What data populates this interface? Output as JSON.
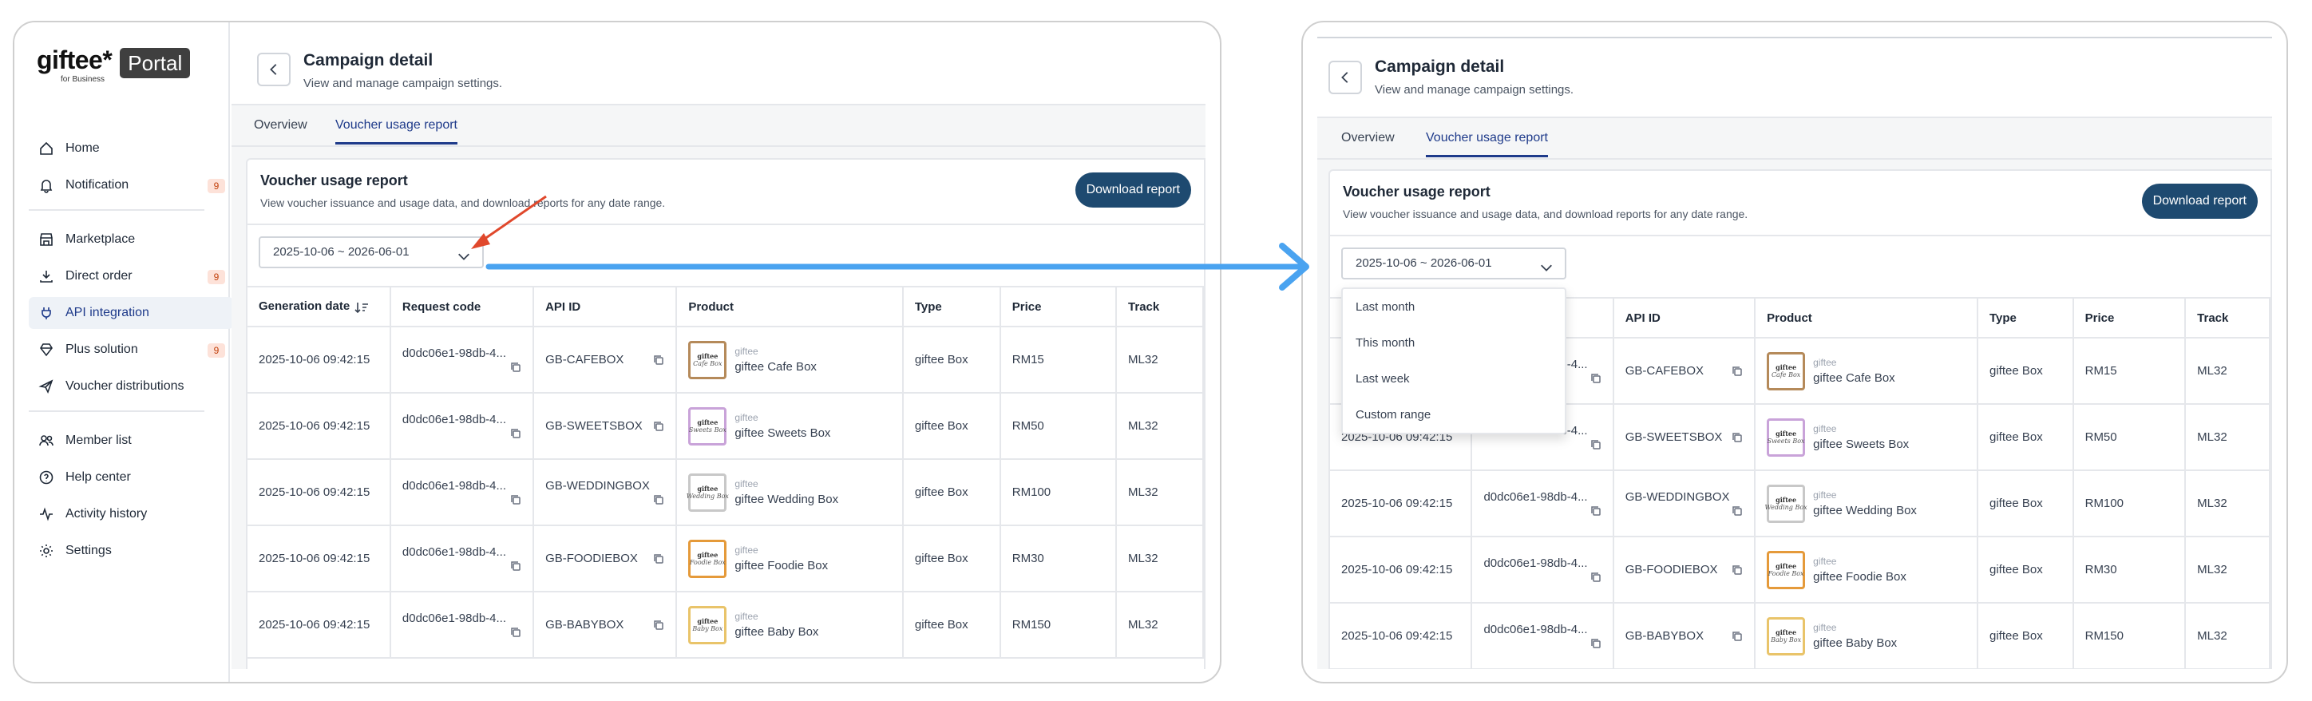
{
  "brand": {
    "logo_text": "giftee*",
    "logo_sub": "for Business",
    "portal_badge": "Portal"
  },
  "sidebar": {
    "groups": [
      [
        {
          "label": "Home",
          "icon": "home-icon",
          "badge": "",
          "active": false
        },
        {
          "label": "Notification",
          "icon": "bell-icon",
          "badge": "9",
          "active": false
        }
      ],
      [
        {
          "label": "Marketplace",
          "icon": "store-icon",
          "badge": "",
          "active": false
        },
        {
          "label": "Direct order",
          "icon": "download-icon",
          "badge": "9",
          "active": false
        },
        {
          "label": "API integration",
          "icon": "plug-icon",
          "badge": "",
          "active": true
        },
        {
          "label": "Plus solution",
          "icon": "diamond-icon",
          "badge": "9",
          "active": false
        },
        {
          "label": "Voucher distributions",
          "icon": "send-icon",
          "badge": "",
          "active": false
        }
      ],
      [
        {
          "label": "Member list",
          "icon": "users-icon",
          "badge": "",
          "active": false
        },
        {
          "label": "Help center",
          "icon": "help-icon",
          "badge": "",
          "active": false
        },
        {
          "label": "Activity history",
          "icon": "activity-icon",
          "badge": "",
          "active": false
        },
        {
          "label": "Settings",
          "icon": "gear-icon",
          "badge": "",
          "active": false
        }
      ]
    ]
  },
  "header": {
    "title": "Campaign detail",
    "subtitle": "View and manage campaign settings."
  },
  "tabs": [
    {
      "label": "Overview",
      "active": false
    },
    {
      "label": "Voucher usage report",
      "active": true
    }
  ],
  "report": {
    "title": "Voucher usage report",
    "description": "View voucher issuance and usage data, and download reports for any date range.",
    "download_label": "Download report",
    "date_range": "2025-10-06 ~ 2026-06-01",
    "date_options": [
      "Last month",
      "This month",
      "Last week",
      "Custom range"
    ],
    "columns": [
      "Generation date",
      "Request code",
      "API ID",
      "Product",
      "Type",
      "Price",
      "Track"
    ],
    "rows": [
      {
        "date": "2025-10-06 09:42:15",
        "request": "d0dc06e1-98db-4...",
        "api_id": "GB-CAFEBOX",
        "brand": "giftee",
        "product": "giftee Cafe Box",
        "thumb": "Cafe Box",
        "thumb_color": "#b58a5a",
        "type": "giftee Box",
        "price": "RM15",
        "track": "ML32"
      },
      {
        "date": "2025-10-06 09:42:15",
        "request": "d0dc06e1-98db-4...",
        "api_id": "GB-SWEETSBOX",
        "brand": "giftee",
        "product": "giftee Sweets Box",
        "thumb": "Sweets Box",
        "thumb_color": "#c9a3d9",
        "type": "giftee Box",
        "price": "RM50",
        "track": "ML32"
      },
      {
        "date": "2025-10-06 09:42:15",
        "request": "d0dc06e1-98db-4...",
        "api_id": "GB-WEDDINGBOX",
        "brand": "giftee",
        "product": "giftee Wedding Box",
        "thumb": "Wedding Box",
        "thumb_color": "#c8c8c8",
        "type": "giftee Box",
        "price": "RM100",
        "track": "ML32"
      },
      {
        "date": "2025-10-06 09:42:15",
        "request": "d0dc06e1-98db-4...",
        "api_id": "GB-FOODIEBOX",
        "brand": "giftee",
        "product": "giftee Foodie Box",
        "thumb": "Foodie Box",
        "thumb_color": "#e59a3a",
        "type": "giftee Box",
        "price": "RM30",
        "track": "ML32"
      },
      {
        "date": "2025-10-06 09:42:15",
        "request": "d0dc06e1-98db-4...",
        "api_id": "GB-BABYBOX",
        "brand": "giftee",
        "product": "giftee Baby Box",
        "thumb": "Baby Box",
        "thumb_color": "#e9c46a",
        "type": "giftee Box",
        "price": "RM150",
        "track": "ML32"
      }
    ]
  },
  "thumb_brand": "giftee",
  "colors": {
    "accent": "#1e3a8a",
    "button": "#1e4a70",
    "annotation_red": "#e0482c",
    "annotation_blue": "#4aa3f0"
  }
}
